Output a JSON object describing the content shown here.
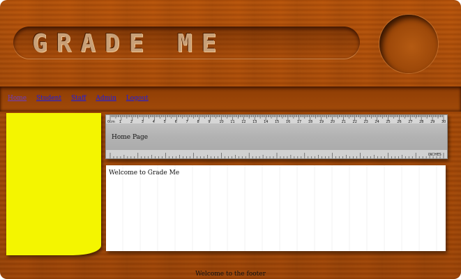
{
  "header": {
    "logo_text": "GRADE ME"
  },
  "nav": {
    "items": [
      {
        "label": "Home"
      },
      {
        "label": "Student"
      },
      {
        "label": "Staff"
      },
      {
        "label": "Admin"
      },
      {
        "label": "Logout"
      }
    ]
  },
  "ruler": {
    "unit": "0cm",
    "top_numbers": [
      "1",
      "2",
      "3",
      "4",
      "5",
      "6",
      "7",
      "8",
      "9",
      "10",
      "11",
      "12",
      "13",
      "14",
      "15",
      "16",
      "17",
      "18",
      "19",
      "20",
      "21",
      "22",
      "23",
      "24",
      "25",
      "26",
      "27",
      "28",
      "29",
      "30"
    ],
    "bottom_unit": "INCHES"
  },
  "page": {
    "title": "Home Page",
    "welcome": "Welcome to Grade Me"
  },
  "footer": {
    "text": "Welcome to the footer"
  }
}
